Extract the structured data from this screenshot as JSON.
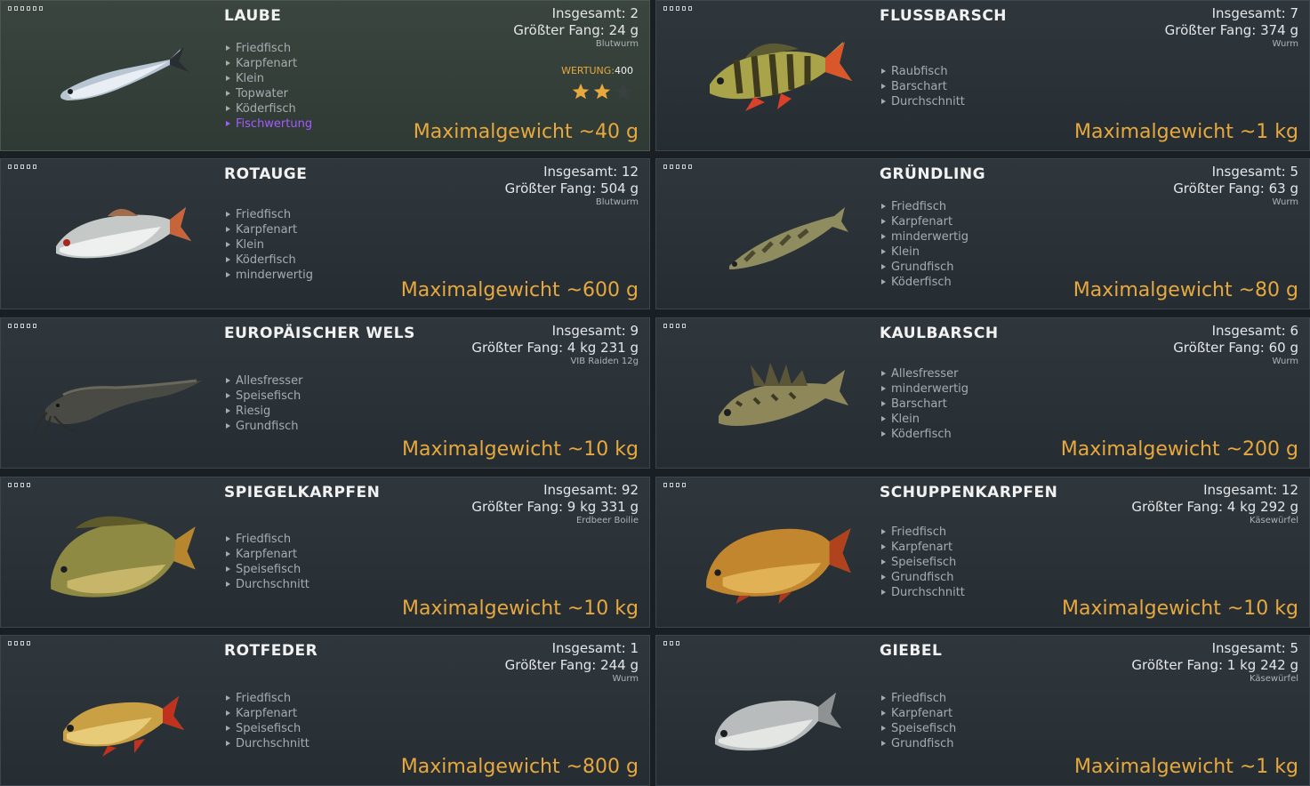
{
  "colors": {
    "accent": "#e7a83d",
    "link": "#a35bff",
    "card_bg": "#2b3338",
    "selected_bg": "#37423c"
  },
  "rating": {
    "label": "WERTUNG:",
    "value": "400",
    "stars_filled": 2,
    "stars_total": 3
  },
  "cards": [
    {
      "name": "LAUBE",
      "dots": 6,
      "selected": true,
      "icon": "bleak-fish-image",
      "tags": [
        "Friedfisch",
        "Karpfenart",
        "Klein",
        "Topwater",
        "Köderfisch",
        "Fischwertung"
      ],
      "total": "Insgesamt: 2",
      "catch": "Größter Fang: 24 g",
      "bait": "Blutwurm",
      "max": "Maximalgewicht ~40 g"
    },
    {
      "name": "FLUSSBARSCH",
      "dots": 5,
      "selected": false,
      "icon": "perch-fish-image",
      "tags": [
        "Raubfisch",
        "Barschart",
        "Durchschnitt"
      ],
      "total": "Insgesamt: 7",
      "catch": "Größter Fang: 374 g",
      "bait": "Wurm",
      "max": "Maximalgewicht ~1 kg"
    },
    {
      "name": "ROTAUGE",
      "dots": 5,
      "selected": false,
      "icon": "roach-fish-image",
      "tags": [
        "Friedfisch",
        "Karpfenart",
        "Klein",
        "Köderfisch",
        "minderwertig"
      ],
      "total": "Insgesamt: 12",
      "catch": "Größter Fang: 504 g",
      "bait": "Blutwurm",
      "max": "Maximalgewicht ~600 g"
    },
    {
      "name": "GRÜNDLING",
      "dots": 5,
      "selected": false,
      "icon": "gudgeon-fish-image",
      "tags": [
        "Friedfisch",
        "Karpfenart",
        "minderwertig",
        "Klein",
        "Grundfisch",
        "Köderfisch"
      ],
      "total": "Insgesamt: 5",
      "catch": "Größter Fang: 63 g",
      "bait": "Wurm",
      "max": "Maximalgewicht ~80 g"
    },
    {
      "name": "EUROPÄISCHER WELS",
      "dots": 5,
      "selected": false,
      "icon": "catfish-image",
      "tags": [
        "Allesfresser",
        "Speisefisch",
        "Riesig",
        "Grundfisch"
      ],
      "total": "Insgesamt: 9",
      "catch": "Größter Fang: 4 kg 231 g",
      "bait": "VIB Raiden 12g",
      "max": "Maximalgewicht ~10 kg"
    },
    {
      "name": "KAULBARSCH",
      "dots": 4,
      "selected": false,
      "icon": "ruffe-fish-image",
      "tags": [
        "Allesfresser",
        "minderwertig",
        "Barschart",
        "Klein",
        "Köderfisch"
      ],
      "total": "Insgesamt: 6",
      "catch": "Größter Fang: 60 g",
      "bait": "Wurm",
      "max": "Maximalgewicht ~200 g"
    },
    {
      "name": "SPIEGELKARPFEN",
      "dots": 4,
      "selected": false,
      "icon": "mirror-carp-image",
      "tags": [
        "Friedfisch",
        "Karpfenart",
        "Speisefisch",
        "Durchschnitt"
      ],
      "total": "Insgesamt: 92",
      "catch": "Größter Fang: 9 kg 331 g",
      "bait": "Erdbeer Boilie",
      "max": "Maximalgewicht ~10 kg"
    },
    {
      "name": "SCHUPPENKARPFEN",
      "dots": 4,
      "selected": false,
      "icon": "common-carp-image",
      "tags": [
        "Friedfisch",
        "Karpfenart",
        "Speisefisch",
        "Grundfisch",
        "Durchschnitt"
      ],
      "total": "Insgesamt: 12",
      "catch": "Größter Fang: 4 kg 292 g",
      "bait": "Käsewürfel",
      "max": "Maximalgewicht ~10 kg"
    },
    {
      "name": "ROTFEDER",
      "dots": 4,
      "selected": false,
      "icon": "rudd-fish-image",
      "tags": [
        "Friedfisch",
        "Karpfenart",
        "Speisefisch",
        "Durchschnitt"
      ],
      "total": "Insgesamt: 1",
      "catch": "Größter Fang: 244 g",
      "bait": "Wurm",
      "max": "Maximalgewicht ~800 g"
    },
    {
      "name": "GIEBEL",
      "dots": 3,
      "selected": false,
      "icon": "prussian-carp-image",
      "tags": [
        "Friedfisch",
        "Karpfenart",
        "Speisefisch",
        "Grundfisch"
      ],
      "total": "Insgesamt: 5",
      "catch": "Größter Fang: 1 kg 242 g",
      "bait": "Käsewürfel",
      "max": "Maximalgewicht ~1 kg"
    }
  ]
}
